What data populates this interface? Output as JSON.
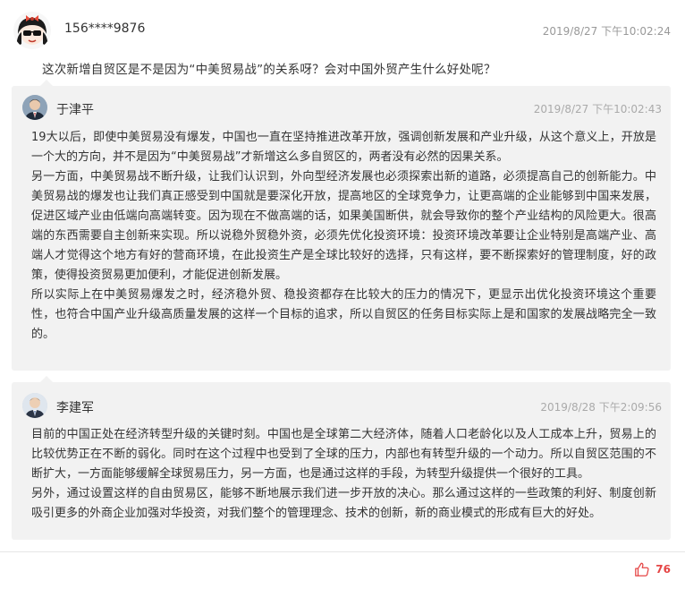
{
  "question": {
    "username": "156****9876",
    "time": "2019/8/27 下午10:02:24",
    "text": "这次新增自贸区是不是因为“中美贸易战”的关系呀？会对中国外贸产生什么好处呢？"
  },
  "answers": [
    {
      "name": "于津平",
      "time": "2019/8/27 下午10:02:43",
      "paragraphs": [
        "19大以后，即使中美贸易没有爆发，中国也一直在坚持推进改革开放，强调创新发展和产业升级，从这个意义上，开放是一个大的方向，并不是因为“中美贸易战”才新增这么多自贸区的，两者没有必然的因果关系。",
        "另一方面，中美贸易战不断升级，让我们认识到，外向型经济发展也必须探索出新的道路，必须提高自己的创新能力。中美贸易战的爆发也让我们真正感受到中国就是要深化开放，提高地区的全球竞争力，让更高端的企业能够到中国来发展，促进区域产业由低端向高端转变。因为现在不做高端的话，如果美国断供，就会导致你的整个产业结构的风险更大。很高端的东西需要自主创新来实现。所以说稳外贸稳外资，必须先优化投资环境：投资环境改革要让企业特别是高端产业、高端人才觉得这个地方有好的营商环境，在此投资生产是全球比较好的选择，只有这样，要不断探索好的管理制度，好的政策，使得投资贸易更加便利，才能促进创新发展。",
        "所以实际上在中美贸易爆发之时，经济稳外贸、稳投资都存在比较大的压力的情况下，更显示出优化投资环境这个重要性，也符合中国产业升级高质量发展的这样一个目标的追求，所以自贸区的任务目标实际上是和国家的发展战略完全一致的。"
      ]
    },
    {
      "name": "李建军",
      "time": "2019/8/28 下午2:09:56",
      "paragraphs": [
        "目前的中国正处在经济转型升级的关键时刻。中国也是全球第二大经济体，随着人口老龄化以及人工成本上升，贸易上的比较优势正在不断的弱化。同时在这个过程中也受到了全球的压力，内部也有转型升级的一个动力。所以自贸区范围的不断扩大，一方面能够缓解全球贸易压力，另一方面，也是通过这样的手段，为转型升级提供一个很好的工具。",
        "另外，通过设置这样的自由贸易区，能够不断地展示我们进一步开放的决心。那么通过这样的一些政策的利好、制度创新吸引更多的外商企业加强对华投资，对我们整个的管理理念、技术的创新，新的商业模式的形成有巨大的好处。"
      ]
    }
  ],
  "footer": {
    "like_count": "76",
    "like_icon": "thumbs-up-icon",
    "accent": "#e54545"
  }
}
